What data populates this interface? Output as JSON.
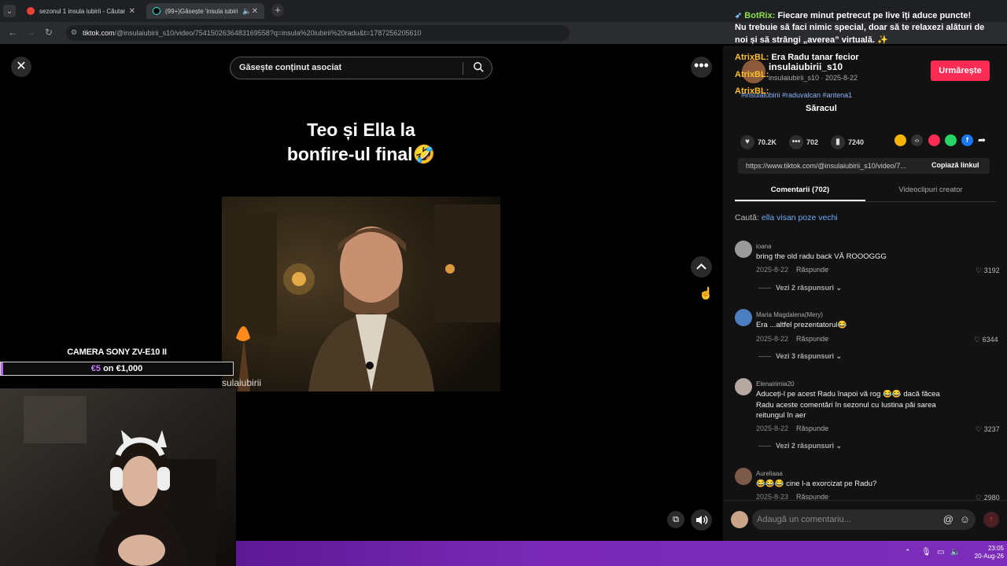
{
  "browser": {
    "tabs": [
      {
        "label": "sezonul 1 insula iubirii - Căutar",
        "active": false
      },
      {
        "label": "(99+)Găsește 'insula iubirii",
        "active": true
      }
    ],
    "url_domain": "tiktok.com",
    "url_path": "/@insulaiubirii_s10/video/7541502636483169558?q=insula%20iubirii%20radu&t=1787256205610"
  },
  "video": {
    "search_placeholder": "Găsește conținut asociat",
    "title_line1": "Teo și Ella la",
    "title_line2": "bonfire-ul final🤣",
    "watermark": "sulaiubirii"
  },
  "stream_overlay": {
    "camera_label": "CAMERA SONY ZV-E10 II",
    "goal_current": "€5",
    "goal_on": "on",
    "goal_target": "€1,000",
    "goal_progress": 0.005
  },
  "chat": {
    "line1_user": "BotRix:",
    "line1_text": " Fiecare minut petrecut pe live îți aduce puncte!",
    "line2_text": "Nu trebuie să faci nimic special, doar să te relaxezi alături de",
    "line3_text": "noi și să strângi „averea” virtuală. ✨",
    "line4_user": "AtrixBL:",
    "line4_text": " Era Radu tanar fecior",
    "line5_user": "AtrixBL:",
    "line6_user": "AtrixBL:",
    "line7_text": "Săracul"
  },
  "post": {
    "username": "insulaiubirii_s10",
    "sub": "insulaiubirii_s10 · 2025-8-22",
    "hashtags": "#insulaiubirii #raduvalcan #antena1",
    "follow_label": "Urmărește",
    "likes": "70.2K",
    "comments": "702",
    "saves": "7240",
    "link": "https://www.tiktok.com/@insulaiubirii_s10/video/7...",
    "copy_label": "Copiază linkul"
  },
  "tabs": {
    "comments": "Comentarii (702)",
    "creator": "Videoclipuri creator"
  },
  "search_hint": {
    "prefix": "Caută: ",
    "query": "ella visan poze vechi"
  },
  "comments": [
    {
      "user": "ioana",
      "text": "bring the old radu back VĂ ROOOGGG",
      "date": "2025-8-22",
      "reply": "Răspunde",
      "likes": "3192",
      "replies": "Vezi 2 răspunsuri"
    },
    {
      "user": "Maria Magdalena(Mery)",
      "text": "Era ...altfel prezentatorul😂",
      "date": "2025-8-22",
      "reply": "Răspunde",
      "likes": "6344",
      "replies": "Vezi 3 răspunsuri"
    },
    {
      "user": "Elenairimia20",
      "text1": "Aduceți-l pe acest Radu înapoi vă rog 😂😂 dacă făcea",
      "text2": "Radu aceste comentări în sezonul cu Iustina păi sarea",
      "text3": "reitungul în aer",
      "date": "2025-8-22",
      "reply": "Răspunde",
      "likes": "3237",
      "replies": "Vezi 2 răspunsuri"
    },
    {
      "user": "Aureliaaa",
      "text": "😂😂😂 cine l-a exorcizat pe Radu?",
      "date": "2025-8-23",
      "reply": "Răspunde",
      "likes": "2980"
    }
  ],
  "add_comment_placeholder": "Adaugă un comentariu...",
  "taskbar": {
    "time": "23:05",
    "date": "20-Aug-26"
  },
  "colors": {
    "accent": "#fe2c55",
    "chat_user": "#ffbf2e",
    "taskbar": "#7a2ab7",
    "goal_fill": "#b06ae0"
  }
}
